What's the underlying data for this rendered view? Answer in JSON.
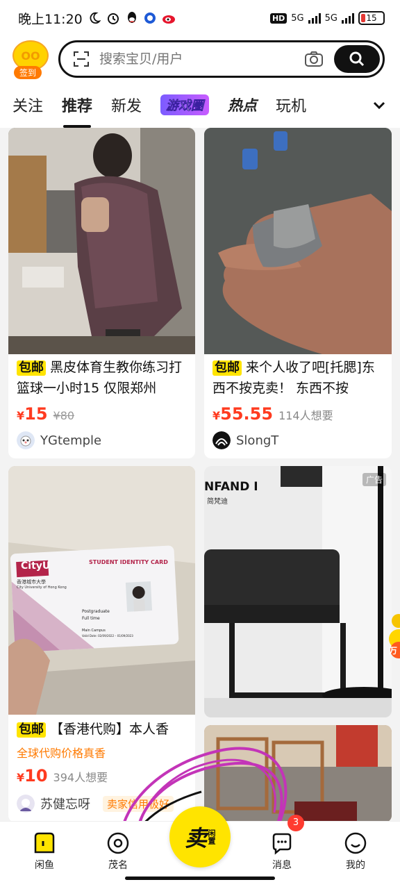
{
  "status": {
    "time": "晚上11:20",
    "hd": "HD",
    "net1": "5G",
    "net2": "5G",
    "battery": "15"
  },
  "header": {
    "checkin": "签到",
    "logo_text": "OO",
    "search_placeholder": "搜索宝贝/用户"
  },
  "tabs": [
    "关注",
    "推荐",
    "新发",
    "游戏圈",
    "热点",
    "玩机"
  ],
  "active_tab": "推荐",
  "feed": [
    {
      "tag": "包邮",
      "title": "黑皮体育生教你练习打篮球一小时15 仅限郑州",
      "price_symbol": "¥",
      "price": "15",
      "old_price": "¥80",
      "seller": "YGtemple"
    },
    {
      "tag": "包邮",
      "title": "来个人收了吧[托腮]东西不按克卖！ 东西不按",
      "price_symbol": "¥",
      "price": "55.55",
      "wants": "114人想要",
      "seller": "SlongT"
    },
    {
      "tag": "包邮",
      "title": "【香港代购】本人香",
      "promo": "全球代购价格真香",
      "price_symbol": "¥",
      "price": "10",
      "wants": "394人想要",
      "seller": "苏健忘呀",
      "seller_tag": "卖家信用极好",
      "card_texts": {
        "brand": "CityU",
        "school_cn": "香港城市大學",
        "school_en": "City University of Hong Kong",
        "card_title": "STUDENT IDENTITY CARD",
        "level": "Postgraduate",
        "mode": "Full time",
        "campus": "Main Campus",
        "valid": "Valid Date: 02/09/2022 – 01/09/2023"
      }
    },
    {
      "ad_label": "广告",
      "brand": "NFAND I",
      "brand_sub": "简梵迪"
    },
    {}
  ],
  "float_side": {
    "label": "万"
  },
  "bottom_nav": {
    "home": "闲鱼",
    "mao": "茂名",
    "sell": "卖",
    "sell_small": "闲置",
    "messages": "消息",
    "messages_badge": "3",
    "me": "我的"
  }
}
